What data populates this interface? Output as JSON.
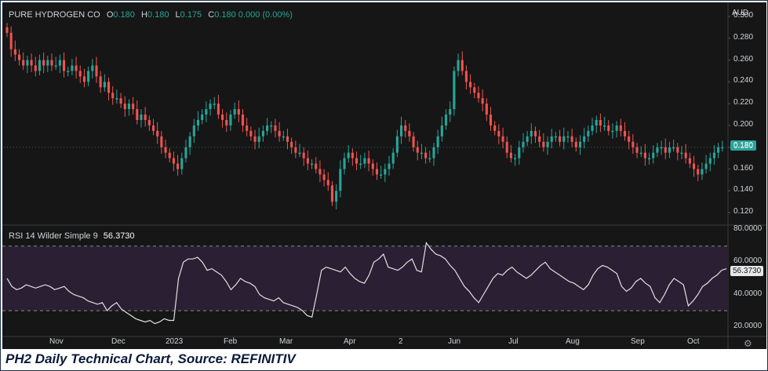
{
  "caption": "PH2 Daily Technical Chart, Source: REFINITIV",
  "legend": {
    "symbol": "PURE HYDROGEN CO",
    "o_key": "O",
    "o_val": "0.180",
    "h_key": "H",
    "h_val": "0.180",
    "l_key": "L",
    "l_val": "0.175",
    "c_key": "C",
    "c_val": "0.180",
    "change": "0.000 (0.00%)"
  },
  "currency": "AUD",
  "price_tag": "0.180",
  "rsi_legend": {
    "label": "RSI 14 Wilder Simple 9",
    "value": "56.3730"
  },
  "rsi_tag": "56.3730",
  "colors": {
    "up": "#26a69a",
    "down": "#ef5350",
    "background": "#161616",
    "rsi_band": "#2a1f33"
  },
  "chart_data": [
    {
      "type": "candlestick",
      "title": "PURE HYDROGEN CO",
      "ylim": [
        0.11,
        0.3
      ],
      "y_ticks": [
        "0.300",
        "0.280",
        "0.260",
        "0.240",
        "0.220",
        "0.200",
        "0.180",
        "0.160",
        "0.140",
        "0.120"
      ],
      "x_ticks": [
        "Nov",
        "Dec",
        "2023",
        "Feb",
        "Mar",
        "Apr",
        "2",
        "Jun",
        "Jul",
        "Aug",
        "Sep",
        "Oct"
      ],
      "close": [
        0.285,
        0.27,
        0.265,
        0.26,
        0.255,
        0.26,
        0.255,
        0.25,
        0.26,
        0.255,
        0.26,
        0.255,
        0.255,
        0.26,
        0.25,
        0.25,
        0.255,
        0.25,
        0.245,
        0.24,
        0.25,
        0.255,
        0.245,
        0.235,
        0.24,
        0.23,
        0.225,
        0.225,
        0.22,
        0.215,
        0.22,
        0.215,
        0.205,
        0.21,
        0.205,
        0.2,
        0.195,
        0.19,
        0.18,
        0.175,
        0.17,
        0.165,
        0.16,
        0.17,
        0.18,
        0.19,
        0.2,
        0.205,
        0.21,
        0.215,
        0.22,
        0.22,
        0.21,
        0.205,
        0.2,
        0.21,
        0.215,
        0.21,
        0.2,
        0.195,
        0.19,
        0.185,
        0.19,
        0.195,
        0.2,
        0.2,
        0.195,
        0.19,
        0.19,
        0.185,
        0.18,
        0.175,
        0.175,
        0.17,
        0.165,
        0.165,
        0.16,
        0.155,
        0.15,
        0.145,
        0.13,
        0.14,
        0.16,
        0.17,
        0.175,
        0.17,
        0.165,
        0.165,
        0.17,
        0.165,
        0.16,
        0.155,
        0.155,
        0.16,
        0.165,
        0.175,
        0.19,
        0.2,
        0.195,
        0.19,
        0.18,
        0.175,
        0.175,
        0.17,
        0.17,
        0.18,
        0.19,
        0.2,
        0.21,
        0.215,
        0.25,
        0.26,
        0.25,
        0.24,
        0.235,
        0.23,
        0.225,
        0.22,
        0.21,
        0.2,
        0.195,
        0.19,
        0.185,
        0.175,
        0.17,
        0.17,
        0.18,
        0.185,
        0.19,
        0.195,
        0.19,
        0.185,
        0.18,
        0.185,
        0.19,
        0.19,
        0.185,
        0.19,
        0.19,
        0.185,
        0.18,
        0.185,
        0.19,
        0.195,
        0.2,
        0.205,
        0.2,
        0.2,
        0.195,
        0.195,
        0.2,
        0.195,
        0.19,
        0.185,
        0.18,
        0.175,
        0.175,
        0.17,
        0.17,
        0.175,
        0.18,
        0.18,
        0.175,
        0.18,
        0.18,
        0.175,
        0.175,
        0.17,
        0.165,
        0.16,
        0.155,
        0.16,
        0.165,
        0.17,
        0.175,
        0.18,
        0.18
      ]
    },
    {
      "type": "line",
      "title": "RSI 14 Wilder Simple 9",
      "ylim": [
        15,
        82
      ],
      "y_ticks": [
        "80.0000",
        "60.0000",
        "40.0000",
        "20.0000"
      ],
      "upper_band": 70,
      "lower_band": 30,
      "values": [
        50,
        45,
        43,
        44,
        46,
        45,
        44,
        45,
        46,
        45,
        43,
        44,
        45,
        42,
        40,
        39,
        38,
        36,
        35,
        34,
        35,
        30,
        33,
        35,
        31,
        29,
        27,
        25,
        24,
        23,
        24,
        22,
        23,
        25,
        24,
        24,
        50,
        60,
        62,
        62,
        63,
        60,
        55,
        56,
        54,
        52,
        48,
        43,
        46,
        50,
        48,
        47,
        45,
        40,
        38,
        37,
        36,
        38,
        35,
        34,
        33,
        32,
        30,
        27,
        26,
        40,
        55,
        57,
        56,
        55,
        54,
        57,
        53,
        50,
        48,
        47,
        52,
        60,
        62,
        65,
        57,
        56,
        55,
        57,
        60,
        62,
        55,
        54,
        72,
        68,
        65,
        64,
        62,
        58,
        55,
        50,
        45,
        42,
        38,
        35,
        40,
        45,
        50,
        53,
        52,
        55,
        57,
        54,
        52,
        50,
        52,
        55,
        58,
        60,
        56,
        54,
        52,
        50,
        48,
        47,
        45,
        43,
        46,
        52,
        56,
        58,
        57,
        55,
        53,
        45,
        42,
        44,
        48,
        50,
        47,
        45,
        38,
        35,
        40,
        46,
        50,
        48,
        46,
        33,
        36,
        40,
        45,
        47,
        50,
        52,
        55,
        56
      ]
    }
  ]
}
